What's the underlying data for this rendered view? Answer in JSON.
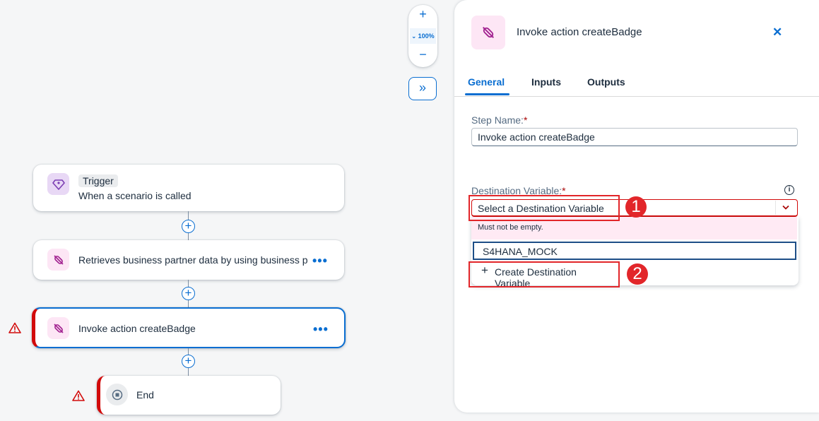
{
  "canvas": {
    "zoom": {
      "zoom_in": "+",
      "level": "100%",
      "zoom_out": "−"
    },
    "expand_glyph": "»",
    "steps": [
      {
        "tag": "Trigger",
        "title": "When a scenario is called"
      },
      {
        "title": "Retrieves business partner data by using business p",
        "more": "•••"
      },
      {
        "title": "Invoke action createBadge",
        "more": "•••"
      },
      {
        "title": "End"
      }
    ],
    "add_glyph": "+"
  },
  "panel": {
    "title": "Invoke action createBadge",
    "close": "✕",
    "tabs": [
      "General",
      "Inputs",
      "Outputs"
    ],
    "step_name_label": "Step Name:",
    "required_mark": "*",
    "step_name_value": "Invoke action createBadge",
    "dest_label": "Destination Variable:",
    "dest_placeholder": "Select a Destination Variable",
    "info": "i",
    "error_text": "Must not be empty.",
    "options": [
      "S4HANA_MOCK"
    ],
    "create_label": "Create Destination Variable",
    "create_plus": "+"
  },
  "annotations": [
    "1",
    "2"
  ],
  "colors": {
    "accent": "#0a6ed1",
    "error": "#d20a0a",
    "highlight": "#e2262a"
  }
}
